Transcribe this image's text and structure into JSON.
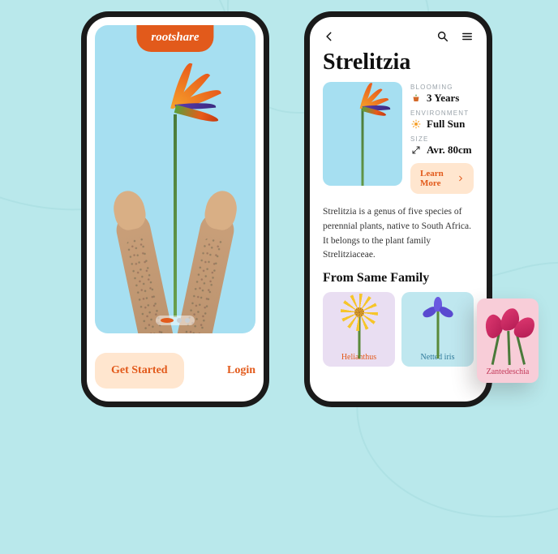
{
  "colors": {
    "accent": "#e25a1b",
    "accentSoft": "#ffe6cf",
    "heroBg": "#a6dff1"
  },
  "brand": "rootshare",
  "onboarding": {
    "get_started": "Get Started",
    "login": "Login"
  },
  "detail": {
    "title": "Strelitzia",
    "facts": {
      "blooming_key": "BLOOMING",
      "blooming_val": "3 Years",
      "env_key": "ENVIRONMENT",
      "env_val": "Full Sun",
      "size_key": "SIZE",
      "size_val": "Avr. 80cm"
    },
    "learn_more": "Learn More",
    "description": "Strelitzia is a genus of five species of perennial plants, native to South Africa. It belongs to the plant family Strelitziaceae.",
    "related_heading": "From Same Family",
    "related": [
      {
        "name": "Helianthus"
      },
      {
        "name": "Netted iris"
      },
      {
        "name": "Zantedeschia"
      }
    ]
  }
}
